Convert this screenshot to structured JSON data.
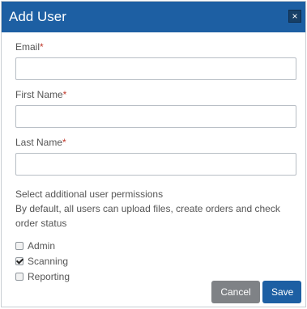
{
  "dialog": {
    "title": "Add User",
    "close_symbol": "×"
  },
  "fields": {
    "email": {
      "label": "Email",
      "required_mark": "*",
      "value": ""
    },
    "first_name": {
      "label": "First Name",
      "required_mark": "*",
      "value": ""
    },
    "last_name": {
      "label": "Last Name",
      "required_mark": "*",
      "value": ""
    }
  },
  "permissions": {
    "title": "Select additional user permissions",
    "description": "By default, all users can upload files, create orders and check order status",
    "options": [
      {
        "label": "Admin",
        "checked": false
      },
      {
        "label": "Scanning",
        "checked": true
      },
      {
        "label": "Reporting",
        "checked": false
      }
    ]
  },
  "actions": {
    "cancel_label": "Cancel",
    "save_label": "Save"
  },
  "colors": {
    "accent": "#1d5fa3",
    "required": "#c0392b",
    "cancel_bg": "#7f8286"
  }
}
